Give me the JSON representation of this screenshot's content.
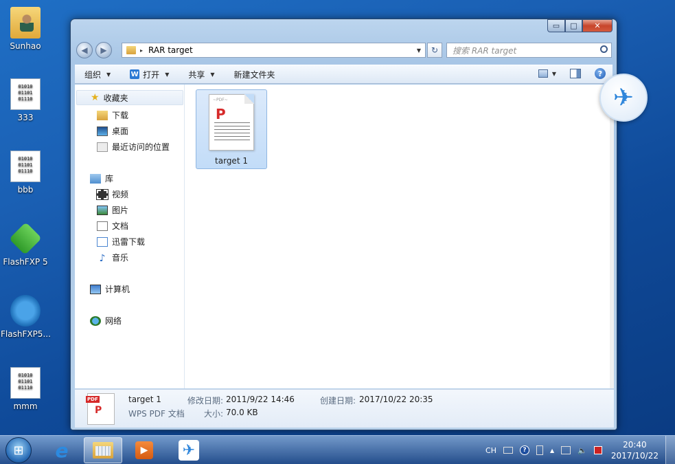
{
  "desktop": {
    "icons": [
      {
        "label": "Sunhao",
        "icon": "user-folder-icon"
      },
      {
        "label": "333",
        "icon": "binary-file-icon"
      },
      {
        "label": "bbb",
        "icon": "binary-file-icon"
      },
      {
        "label": "FlashFXP 5",
        "icon": "flashfxp-icon"
      },
      {
        "label": "FlashFXP5...",
        "icon": "flashfxp-setup-icon"
      },
      {
        "label": "mmm",
        "icon": "binary-file-icon"
      }
    ],
    "binary_glyph": "01010\n01101\n01110"
  },
  "window": {
    "controls": {
      "minimize": "▭",
      "maximize": "□",
      "close": "✕"
    },
    "nav": {
      "back": "◀",
      "forward": "▶"
    },
    "breadcrumb_arrow": "▸",
    "address": "RAR target",
    "address_dropdown": "▼",
    "refresh": "↻",
    "search_placeholder": "搜索 RAR target"
  },
  "toolbar": {
    "organize": "组织",
    "open": "打开",
    "open_icon_letter": "W",
    "share": "共享",
    "new_folder": "新建文件夹",
    "caret": "▼",
    "help": "?"
  },
  "navpane": {
    "favorites": {
      "label": "收藏夹",
      "star": "★"
    },
    "fav_items": [
      "下载",
      "桌面",
      "最近访问的位置"
    ],
    "library": "库",
    "lib_items": [
      "视频",
      "图片",
      "文档",
      "迅雷下载",
      "音乐"
    ],
    "music_note": "♪",
    "computer": "计算机",
    "network": "网络"
  },
  "content": {
    "files": [
      {
        "name": "target 1",
        "type": "pdf"
      }
    ],
    "pdf_tag": "~PDF~",
    "pdf_logo": "P"
  },
  "details": {
    "name": "target 1",
    "type": "WPS PDF 文档",
    "badge": "PDF",
    "logo": "P",
    "modified_label": "修改日期:",
    "modified": "2011/9/22 14:46",
    "size_label": "大小:",
    "size": "70.0 KB",
    "created_label": "创建日期:",
    "created": "2017/10/22 20:35"
  },
  "floating": {
    "bird": "✈"
  },
  "taskbar": {
    "start_glyph": "⊞",
    "ie_glyph": "e",
    "player_glyph": "▶",
    "bird_glyph": "✈",
    "tray": {
      "lang": "CH",
      "help": "?",
      "up_arrow": "▲",
      "volume": "🔈",
      "time": "20:40",
      "date": "2017/10/22"
    }
  },
  "colors": {
    "desktop": "#1a5fb3",
    "window_frame": "#a8c6e6",
    "selection": "#c2dcf8",
    "close_button": "#c7452b",
    "pdf_red": "#d62a2a"
  }
}
